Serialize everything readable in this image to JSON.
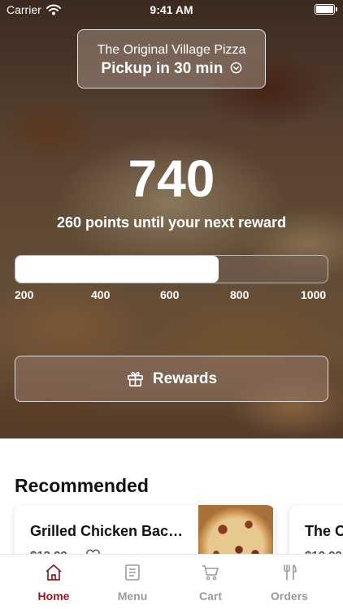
{
  "status_bar": {
    "carrier": "Carrier",
    "time": "9:41 AM"
  },
  "store": {
    "name": "The Original Village Pizza",
    "pickup": "Pickup in 30 min"
  },
  "rewards": {
    "points": "740",
    "subtitle": "260 points until your next reward",
    "progress_fraction": 0.65,
    "ticks": [
      "200",
      "400",
      "600",
      "800",
      "1000"
    ],
    "button_label": "Rewards"
  },
  "recommended": {
    "title": "Recommended",
    "items": [
      {
        "name": "Grilled Chicken Bac…",
        "price": "$12.99"
      },
      {
        "name": "The O",
        "price": "$12.99"
      }
    ]
  },
  "tabs": [
    {
      "label": "Home",
      "icon": "home-icon",
      "active": true
    },
    {
      "label": "Menu",
      "icon": "menu-icon",
      "active": false
    },
    {
      "label": "Cart",
      "icon": "cart-icon",
      "active": false
    },
    {
      "label": "Orders",
      "icon": "orders-icon",
      "active": false
    }
  ],
  "colors": {
    "accent": "#8a1d2a",
    "tab_inactive": "#9a9a9a"
  }
}
